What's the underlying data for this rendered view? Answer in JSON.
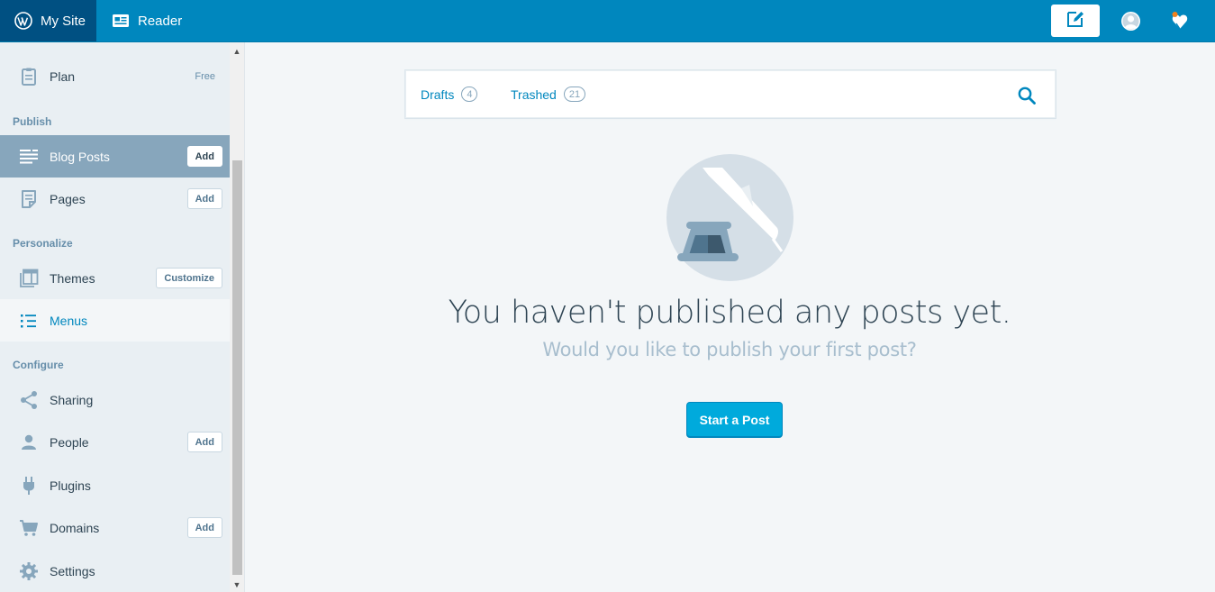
{
  "masterbar": {
    "mysite_label": "My Site",
    "reader_label": "Reader",
    "write_icon": "edit-icon",
    "me_icon": "user-avatar-icon",
    "notifications_icon": "bell-icon"
  },
  "sidebar": {
    "plan": {
      "label": "Plan",
      "badge": "Free"
    },
    "headings": {
      "publish": "Publish",
      "personalize": "Personalize",
      "configure": "Configure"
    },
    "items": [
      {
        "label": "Blog Posts",
        "button": "Add"
      },
      {
        "label": "Pages",
        "button": "Add"
      },
      {
        "label": "Themes",
        "button": "Customize"
      },
      {
        "label": "Menus"
      },
      {
        "label": "Sharing"
      },
      {
        "label": "People",
        "button": "Add"
      },
      {
        "label": "Plugins"
      },
      {
        "label": "Domains",
        "button": "Add"
      },
      {
        "label": "Settings"
      }
    ]
  },
  "section_nav": {
    "tabs": [
      {
        "label": "Drafts",
        "count": "4"
      },
      {
        "label": "Trashed",
        "count": "21"
      }
    ]
  },
  "empty": {
    "title": "You haven't published any posts yet.",
    "subtitle": "Would you like to publish your first post?",
    "action": "Start a Post"
  },
  "colors": {
    "brand": "#0087be",
    "brand_dark": "#005082",
    "accent": "#00aadc",
    "sidebar_bg": "#e9eff3",
    "selected_bg": "#87a6bc"
  }
}
